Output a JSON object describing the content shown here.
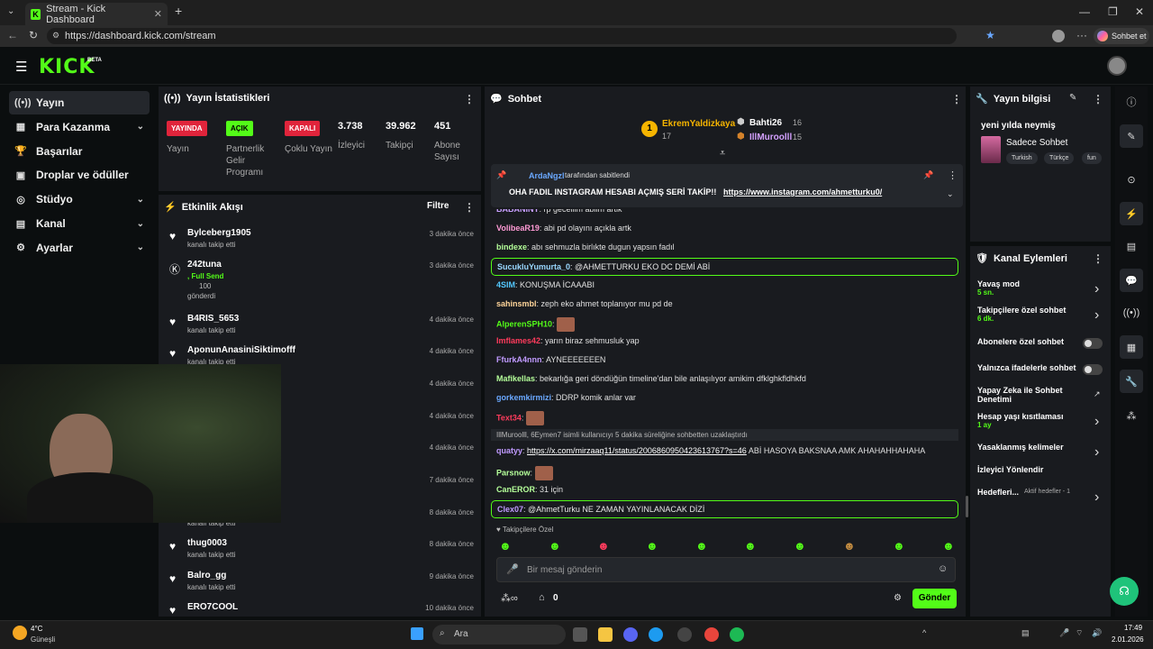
{
  "browser": {
    "tab_title": "Stream - Kick Dashboard",
    "url": "https://dashboard.kick.com/stream",
    "profile_btn": "Sohbet et"
  },
  "app": {
    "logo": "KICK",
    "beta": "BETA"
  },
  "sidebar": {
    "items": [
      {
        "label": "Yayın",
        "icon": "broadcast-icon",
        "active": true
      },
      {
        "label": "Para Kazanma",
        "icon": "money-icon",
        "chevron": true
      },
      {
        "label": "Başarılar",
        "icon": "trophy-icon"
      },
      {
        "label": "Droplar ve ödüller",
        "icon": "gift-icon"
      },
      {
        "label": "Stüdyo",
        "icon": "studio-icon",
        "chevron": true
      },
      {
        "label": "Kanal",
        "icon": "channel-icon",
        "chevron": true
      },
      {
        "label": "Ayarlar",
        "icon": "gear-icon",
        "chevron": true
      }
    ]
  },
  "stats": {
    "title": "Yayın İstatistikleri",
    "badges": [
      {
        "text": "YAYINDA",
        "label": "Yayın",
        "color": "#e0243b"
      },
      {
        "text": "AÇIK",
        "label": "Partnerlik Gelir Programı",
        "color": "#53fc18"
      },
      {
        "text": "KAPALI",
        "label": "Çoklu Yayın",
        "color": "#e0243b"
      }
    ],
    "numbers": [
      {
        "value": "3.738",
        "label": "İzleyici"
      },
      {
        "value": "39.962",
        "label": "Takipçi"
      },
      {
        "value": "451",
        "label": "Abone Sayısı"
      }
    ]
  },
  "activity": {
    "title": "Etkinlik Akışı",
    "filter": "Filtre",
    "rows": [
      {
        "name": "Bylceberg1905",
        "sub": "kanalı takip etti",
        "time": "3 dakika önce"
      },
      {
        "name": "242tuna",
        "sub": ", Full Send",
        "extra": "100",
        "extra2": "gönderdi",
        "time": "3 dakika önce"
      },
      {
        "name": "B4RIS_5653",
        "sub": "kanalı takip etti",
        "time": "4 dakika önce"
      },
      {
        "name": "AponunAnasiniSiktimofff",
        "sub": "kanalı takip etti",
        "time": "4 dakika önce"
      },
      {
        "time": "4 dakika önce"
      },
      {
        "time": "4 dakika önce"
      },
      {
        "time": "4 dakika önce"
      },
      {
        "time": "7 dakika önce"
      },
      {
        "sub": "kanalı takip etti",
        "time": "8 dakika önce"
      },
      {
        "name": "thug0003",
        "sub": "kanalı takip etti",
        "time": "8 dakika önce"
      },
      {
        "name": "Balro_gg",
        "sub": "kanalı takip etti",
        "time": "9 dakika önce"
      },
      {
        "name": "ERO7COOL",
        "time": "10 dakika önce"
      }
    ]
  },
  "chat": {
    "title": "Sohbet",
    "top": [
      {
        "name": "EkremYaldizkaya",
        "count": "17"
      },
      {
        "name": "Bahti26",
        "count": "16"
      },
      {
        "name": "IllMuroolll",
        "count": "15"
      }
    ],
    "pinned": {
      "by": "ArdaNgzl",
      "by_suffix": "tarafından sabitlendi",
      "text": "OHA FADIL INSTAGRAM HESABI AÇMIŞ SERİ TAKİP!!",
      "link": "https://www.instagram.com/ahmetturku0/"
    },
    "messages": [
      {
        "user": "BABANINY",
        "text": "rp geceliim abiim artik",
        "color": "#c9a0ff"
      },
      {
        "user": "VolibeaR19",
        "text": "abi pd olayını açıkla artk",
        "color": "#ff9ad5"
      },
      {
        "user": "bindexe",
        "text": "abı sehmuzla birlıkte dugun yapsın fadıl",
        "color": "#b5ff9a"
      },
      {
        "user": "SucukluYumurta_0",
        "text": "@AHMETTURKU EKO DC DEMİ ABİ",
        "color": "#9ad8ff",
        "highlight": true
      },
      {
        "user": "4SIM",
        "text": "KONUŞMA İCAAABI",
        "color": "#53c8ff"
      },
      {
        "user": "sahinsmbl",
        "text": "zeph eko ahmet toplanıyor mu pd de",
        "color": "#ffd59a"
      },
      {
        "user": "AlperenSPH10",
        "text": "",
        "color": "#53fc18"
      },
      {
        "user": "Imflames42",
        "text": "yarın biraz sehmusluk yap",
        "color": "#ff3b5c"
      },
      {
        "user": "FfurkA4nnn",
        "text": "AYNEEEEEEEN",
        "color": "#c09aff"
      },
      {
        "user": "Mafikellas",
        "text": "bekarlığa geri döndüğün timeline'dan bile anlaşılıyor amikim dfklghkfldhkfd",
        "color": "#b5ff9a"
      },
      {
        "user": "gorkemkirmizi",
        "text": "DDRP komik anlar var",
        "color": "#6aa8ff"
      },
      {
        "user": "Text34",
        "text": "",
        "color": "#ff3b5c"
      },
      {
        "system": "IllMuroolll, 6Eymen7 isimli kullanıcıyı 5 dakika süreliğine sohbetten uzaklaştırdı"
      },
      {
        "user": "quatyy",
        "link": "https://x.com/mirzaaq11/status/2006860950423613767?s=46",
        "text": "ABİ HASOYA BAKSNAA AMK AHAHAHHAHAHA",
        "color": "#c09aff"
      },
      {
        "user": "Parsnow",
        "text": "",
        "color": "#b5ff9a"
      },
      {
        "user": "CanEROR",
        "text": "31 için",
        "color": "#b5ff9a"
      },
      {
        "user": "Clex07",
        "text": "@AhmetTurku NE ZAMAN YAYINLANACAK DİZİ",
        "color": "#c09aff",
        "highlight": true
      }
    ],
    "followers_only": "Takipçilere Özel",
    "placeholder": "Bir mesaj gönderin",
    "send": "Gönder",
    "gift_count": "0"
  },
  "info": {
    "title": "Yayın bilgisi",
    "stream_title": "yeni yılda neymiş",
    "category": "Sadece Sohbet",
    "tags": [
      "Turkish",
      "Türkçe",
      "fun"
    ]
  },
  "actions": {
    "title": "Kanal Eylemleri",
    "rows": [
      {
        "label": "Yavaş mod",
        "sub": "5 sn.",
        "type": "chevron"
      },
      {
        "label": "Takipçilere özel sohbet",
        "sub": "6 dk.",
        "type": "chevron"
      },
      {
        "label": "Abonelere özel sohbet",
        "type": "toggle"
      },
      {
        "label": "Yalnızca ifadelerle sohbet",
        "type": "toggle"
      },
      {
        "label": "Yapay Zeka ile Sohbet Denetimi",
        "type": "external"
      },
      {
        "label": "Hesap yaşı kısıtlaması",
        "sub": "1 ay",
        "type": "chevron"
      },
      {
        "label": "Yasaklanmış kelimeler",
        "type": "chevron"
      },
      {
        "label": "İzleyici Yönlendir",
        "type": "none"
      },
      {
        "label": "Hedefleri...",
        "sub": "Aktif hedefler - 1",
        "type": "chevron"
      }
    ]
  },
  "taskbar": {
    "weather_temp": "4°C",
    "weather_desc": "Güneşli",
    "search": "Ara",
    "time": "17:49",
    "date": "2.01.2026"
  }
}
